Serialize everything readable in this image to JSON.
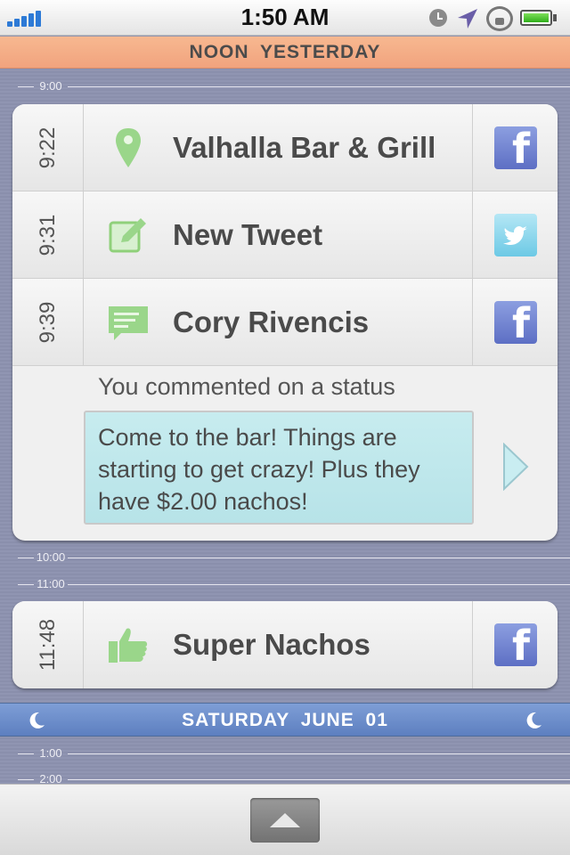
{
  "status_bar": {
    "time": "1:50 AM",
    "icons": [
      "signal-icon",
      "clock-icon",
      "location-arrow-icon",
      "rotation-lock-icon",
      "battery-icon"
    ]
  },
  "sections": {
    "top_header": "NOON  YESTERDAY",
    "date_banner": "SATURDAY  JUNE 01"
  },
  "hour_marks": [
    "9:00",
    "10:00",
    "11:00",
    "1:00",
    "2:00"
  ],
  "events": [
    {
      "time": "9:22",
      "title": "Valhalla Bar & Grill",
      "icon": "location-pin-icon",
      "app": "facebook-icon",
      "app_glyph": "f"
    },
    {
      "time": "9:31",
      "title": "New Tweet",
      "icon": "compose-icon",
      "app": "twitter-icon"
    },
    {
      "time": "9:39",
      "title": "Cory Rivencis",
      "icon": "comment-icon",
      "app": "facebook-icon",
      "app_glyph": "f",
      "detail": {
        "subtitle": "You commented on a status",
        "message": "Come to the bar! Things are starting to get crazy! Plus they have $2.00 nachos!"
      }
    },
    {
      "time": "11:48",
      "title": "Super Nachos",
      "icon": "thumbs-up-icon",
      "app": "facebook-icon",
      "app_glyph": "f"
    }
  ],
  "colors": {
    "header_orange": "#f1a37e",
    "banner_blue": "#6b8cca",
    "icon_green": "#8fd07a",
    "bubble_teal": "#c0e8ec"
  }
}
